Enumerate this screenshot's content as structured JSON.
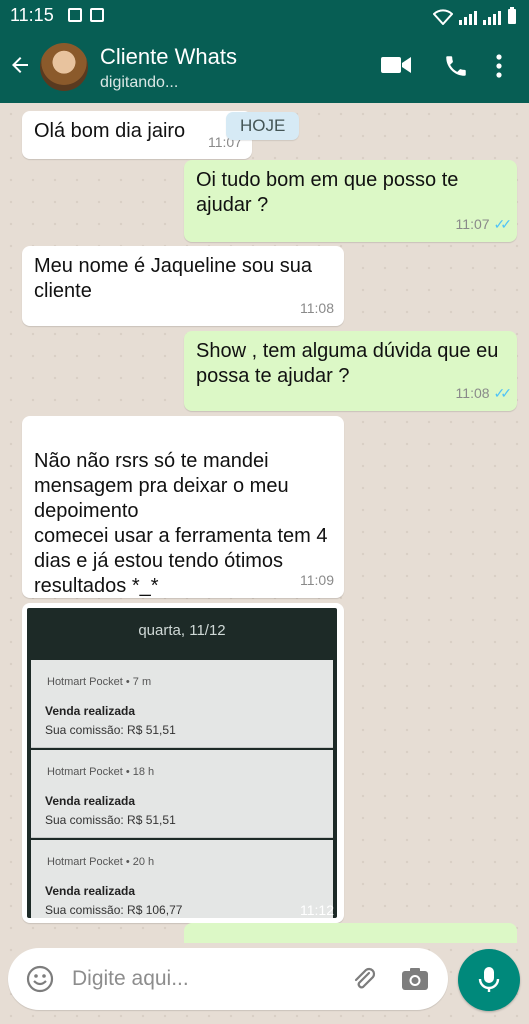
{
  "status_bar": {
    "time": "11:15"
  },
  "header": {
    "contact_name": "Cliente Whats",
    "contact_status": "digitando..."
  },
  "chat": {
    "date_chip": "HOJE",
    "messages": [
      {
        "direction": "in",
        "text": "Olá bom dia jairo",
        "time": "11:07"
      },
      {
        "direction": "out",
        "text": "Oi tudo bom em que posso te ajudar ?",
        "time": "11:07"
      },
      {
        "direction": "in",
        "text": "Meu nome é Jaqueline sou sua cliente",
        "time": "11:08"
      },
      {
        "direction": "out",
        "text": "Show , tem alguma dúvida que eu possa te ajudar ?",
        "time": "11:08"
      },
      {
        "direction": "in",
        "text": "Não não rsrs só te mandei mensagem pra deixar o meu depoimento\ncomecei usar a ferramenta tem 4 dias e já estou tendo ótimos resultados *_*",
        "time": "11:09"
      }
    ],
    "image_message": {
      "time": "11:12",
      "screen_date": "quarta, 11/12",
      "notifications": [
        {
          "app": "Hotmart Pocket • 7 m",
          "title": "Venda realizada",
          "desc": "Sua comissão: R$ 51,51"
        },
        {
          "app": "Hotmart Pocket • 18 h",
          "title": "Venda realizada",
          "desc": "Sua comissão: R$ 51,51"
        },
        {
          "app": "Hotmart Pocket • 20 h",
          "title": "Venda realizada",
          "desc": "Sua comissão: R$ 106,77"
        }
      ]
    }
  },
  "composer": {
    "placeholder": "Digite aqui..."
  },
  "colors": {
    "header": "#075e54",
    "outgoing": "#dcf8c6",
    "incoming": "#ffffff",
    "accent": "#00897b",
    "read_ticks": "#4fc3f7"
  }
}
